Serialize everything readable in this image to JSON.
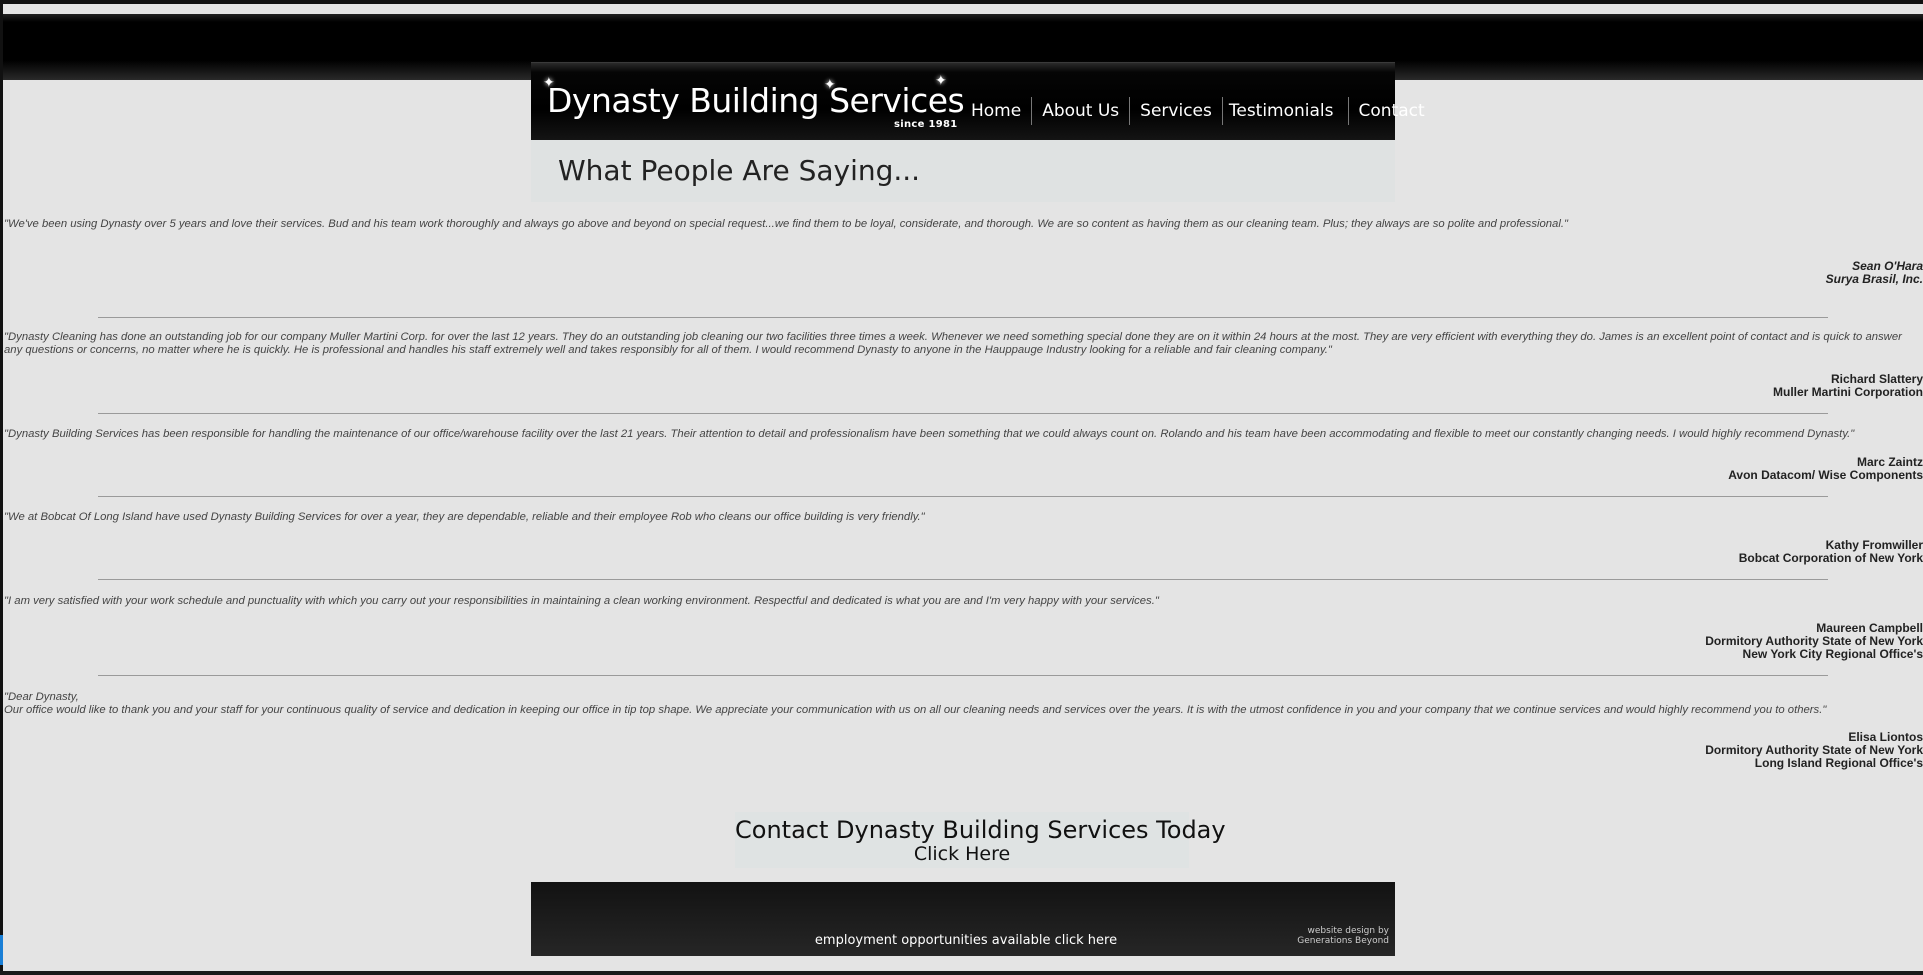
{
  "header": {
    "logo_text": "Dynasty Building Services",
    "logo_since": "since 1981",
    "nav": [
      "Home",
      "About Us",
      "Services",
      "Testimonials",
      "Contact"
    ]
  },
  "page_title": "What People Are Saying...",
  "testimonials": [
    {
      "quote": "\"We've been using Dynasty over 5 years and love their services. Bud and his team work thoroughly and always go above and beyond on special request...we find them to be loyal, considerate, and thorough. We are so content as having them as our cleaning team. Plus; they always are so polite and professional.\"",
      "name": "Sean O'Hara",
      "company": "Surya Brasil, Inc."
    },
    {
      "quote": "\"Dynasty Cleaning has done an outstanding job for our company Muller Martini Corp. for over the last 12 years. They do an outstanding job cleaning our two facilities three times a week. Whenever we need something special done they are on it within 24 hours at the most. They are very efficient with everything they do. James is an excellent point of contact and is quick to answer any questions or concerns, no matter where he is quickly. He is professional and handles his staff extremely well and takes responsibly for all of them. I would recommend Dynasty to anyone in the Hauppauge Industry looking for a reliable and fair cleaning company.\"",
      "name": "Richard Slattery",
      "company": "Muller Martini Corporation"
    },
    {
      "quote": "\"Dynasty Building Services has been responsible for handling the maintenance of our office/warehouse facility over the last 21 years. Their attention to detail and professionalism have been something that we could always count on. Rolando and his team have been accommodating and flexible to meet our constantly changing needs. I would highly recommend Dynasty.\"",
      "name": "Marc Zaintz",
      "company": "Avon Datacom/ Wise Components"
    },
    {
      "quote": "\"We at Bobcat Of Long Island have used Dynasty Building Services for over a year, they are dependable, reliable and their employee Rob who cleans our office building is very friendly.\"",
      "name": "Kathy Fromwiller",
      "company": "Bobcat Corporation of New York"
    },
    {
      "quote": "\"I am very satisfied with your work schedule and punctuality with which you carry out your responsibilities in maintaining a clean working environment. Respectful and dedicated is what you are and I'm very happy with your services.\"",
      "name": "Maureen Campbell",
      "company": "Dormitory Authority State of New York",
      "company2": "New York City Regional Office's"
    },
    {
      "quote_line1": "\"Dear Dynasty,",
      "quote": "Our office would like to thank you and your staff for your continuous quality of service and dedication in keeping our office in tip top shape. We appreciate your communication with us on all our cleaning needs and services over the years. It is with the utmost confidence in you and your company that we continue services and would highly recommend you to others.\"",
      "name": "Elisa Liontos",
      "company": "Dormitory Authority State of New York",
      "company2": "Long Island Regional Office's"
    }
  ],
  "contact_cta": {
    "line1": "Contact Dynasty Building Services Today",
    "line2": "Click Here"
  },
  "footer": {
    "employment": "employment opportunities available click here",
    "credit_line1": "website design by",
    "credit_line2": "Generations Beyond"
  }
}
